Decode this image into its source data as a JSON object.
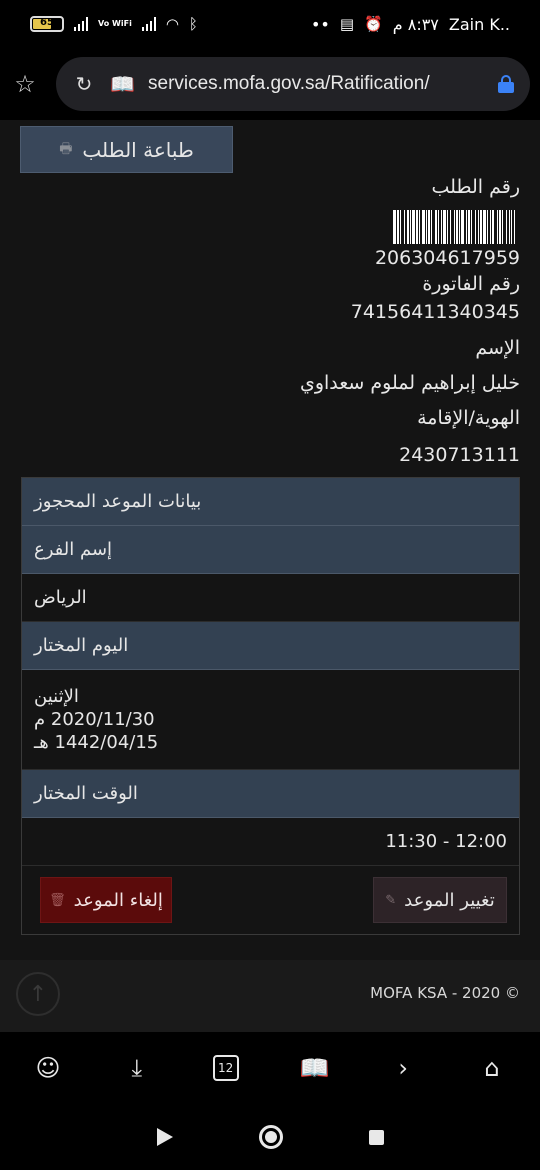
{
  "status_bar": {
    "battery": "65",
    "battery_level": 0.65,
    "vowifi": "Vo WiFi",
    "carrier": "Zain K..",
    "time": "٨:٣٧ م",
    "dots": "••"
  },
  "browser": {
    "url": "services.mofa.gov.sa/Ratification/"
  },
  "page": {
    "print_button": "طباعة الطلب",
    "request_number_label": "رقم الطلب",
    "request_number": "206304617959",
    "invoice_label": "رقم الفاتورة",
    "invoice_number": "74156411340345",
    "name_label": "الإسم",
    "name_value": "خليل إبراهيم لملوم سعداوي",
    "id_label": "الهوية/الإقامة",
    "id_value": "2430713111",
    "appointment": {
      "title": "بيانات الموعد المحجوز",
      "branch_label": "إسم الفرع",
      "branch_value": "الرياض",
      "day_label": "اليوم المختار",
      "day_name": "الإثنين",
      "gregorian_date": "2020/11/30 م",
      "hijri_date": "1442/04/15 هـ",
      "time_label": "الوقت المختار",
      "time_value": "11:30 - 12:00",
      "change_button": "تغيير الموعد",
      "cancel_button": "إلغاء الموعد"
    },
    "footer": {
      "copyright": "MOFA KSA - 2020 ©"
    }
  },
  "toolbar": {
    "tabs_count": "12"
  }
}
